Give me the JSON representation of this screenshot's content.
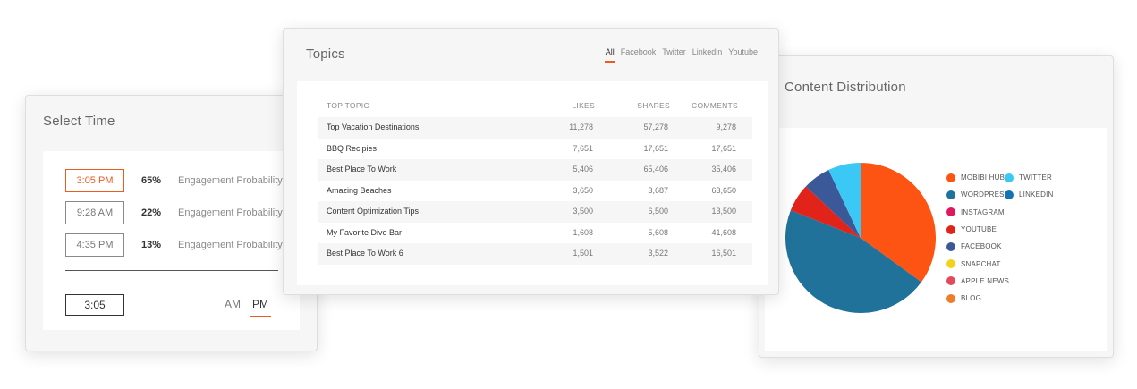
{
  "select_time": {
    "title": "Select Time",
    "slots": [
      {
        "time": "3:05 PM",
        "percent": "65%",
        "label": "Engagement Probability",
        "selected": true
      },
      {
        "time": "9:28 AM",
        "percent": "22%",
        "label": "Engagement Probability",
        "selected": false
      },
      {
        "time": "4:35 PM",
        "percent": "13%",
        "label": "Engagement Probability",
        "selected": false
      }
    ],
    "time_value": "3:05",
    "am_label": "AM",
    "pm_label": "PM"
  },
  "topics": {
    "title": "Topics",
    "tabs": [
      "All",
      "Facebook",
      "Twitter",
      "Linkedin",
      "Youtube"
    ],
    "active_tab": "All",
    "columns": [
      "TOP TOPIC",
      "LIKES",
      "SHARES",
      "COMMENTS"
    ],
    "rows": [
      [
        "Top Vacation Destinations",
        "11,278",
        "57,278",
        "9,278"
      ],
      [
        "BBQ Recipies",
        "7,651",
        "17,651",
        "17,651"
      ],
      [
        "Best Place To Work",
        "5,406",
        "65,406",
        "35,406"
      ],
      [
        "Amazing Beaches",
        "3,650",
        "3,687",
        "63,650"
      ],
      [
        "Content Optimization Tips",
        "3,500",
        "6,500",
        "13,500"
      ],
      [
        "My Favorite Dive Bar",
        "1,608",
        "5,608",
        "41,608"
      ],
      [
        "Best Place To Work 6",
        "1,501",
        "3,522",
        "16,501"
      ]
    ]
  },
  "content_distribution": {
    "title": "Content Distribution",
    "legend_left": [
      {
        "label": "MOBIBI HUB",
        "color": "#fd5413"
      },
      {
        "label": "WORDPRESS",
        "color": "#21729a"
      },
      {
        "label": "INSTAGRAM",
        "color": "#e0185e"
      },
      {
        "label": "YOUTUBE",
        "color": "#e2231a"
      },
      {
        "label": "FACEBOOK",
        "color": "#3b5998"
      },
      {
        "label": "SNAPCHAT",
        "color": "#f2d21a"
      },
      {
        "label": "APPLE NEWS",
        "color": "#e34a5b"
      },
      {
        "label": "BLOG",
        "color": "#f07b28"
      }
    ],
    "legend_right": [
      {
        "label": "TWITTER",
        "color": "#3cc8f5"
      },
      {
        "label": "LINKEDIN",
        "color": "#1373b5"
      }
    ]
  },
  "chart_data": {
    "type": "pie",
    "slices": [
      {
        "label": "MOBIBI HUB",
        "value": 35,
        "color": "#fd5413"
      },
      {
        "label": "WORDPRESS",
        "value": 46,
        "color": "#21729a"
      },
      {
        "label": "YOUTUBE",
        "value": 6,
        "color": "#e2231a"
      },
      {
        "label": "FACEBOOK",
        "value": 6,
        "color": "#3b5998"
      },
      {
        "label": "TWITTER",
        "value": 7,
        "color": "#3cc8f5"
      }
    ]
  }
}
